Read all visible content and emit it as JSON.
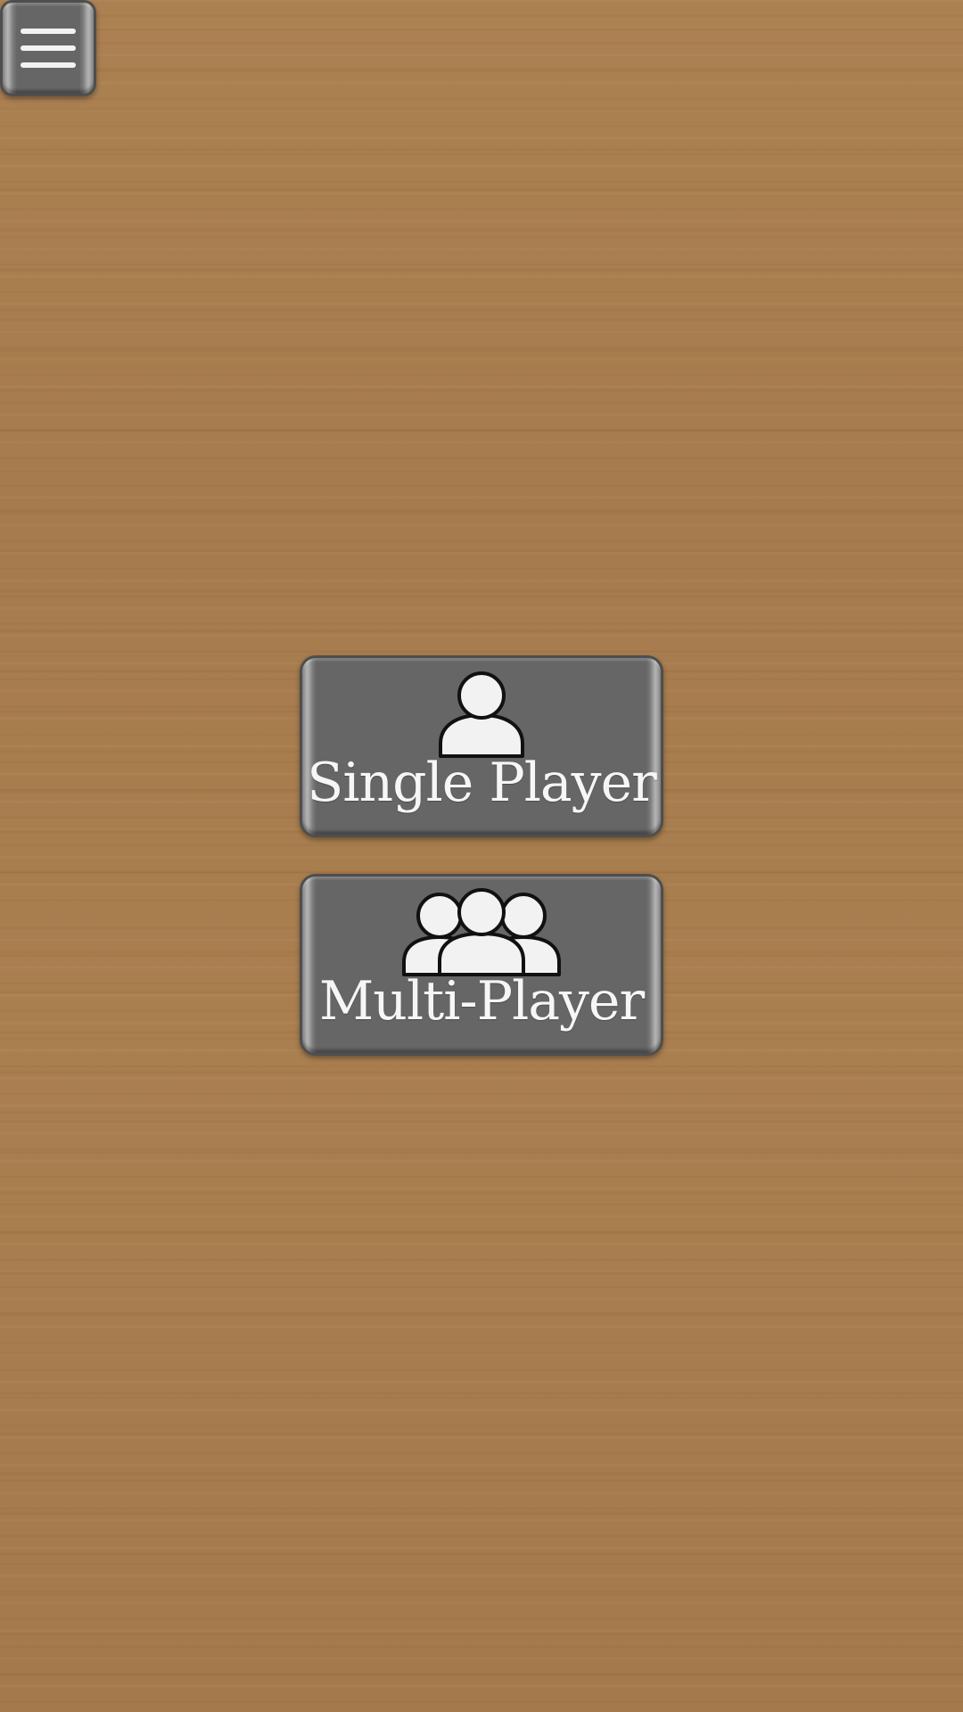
{
  "menu": {
    "icon": "hamburger-menu-icon"
  },
  "modes": {
    "single": {
      "label": "Single Player",
      "icon": "single-person-icon"
    },
    "multi": {
      "label": "Multi-Player",
      "icon": "group-people-icon"
    }
  },
  "colors": {
    "button_face": "#666666",
    "button_border": "#4e4e4e",
    "label_text": "#f6f6f6",
    "wood_background": "#a87d4f"
  }
}
